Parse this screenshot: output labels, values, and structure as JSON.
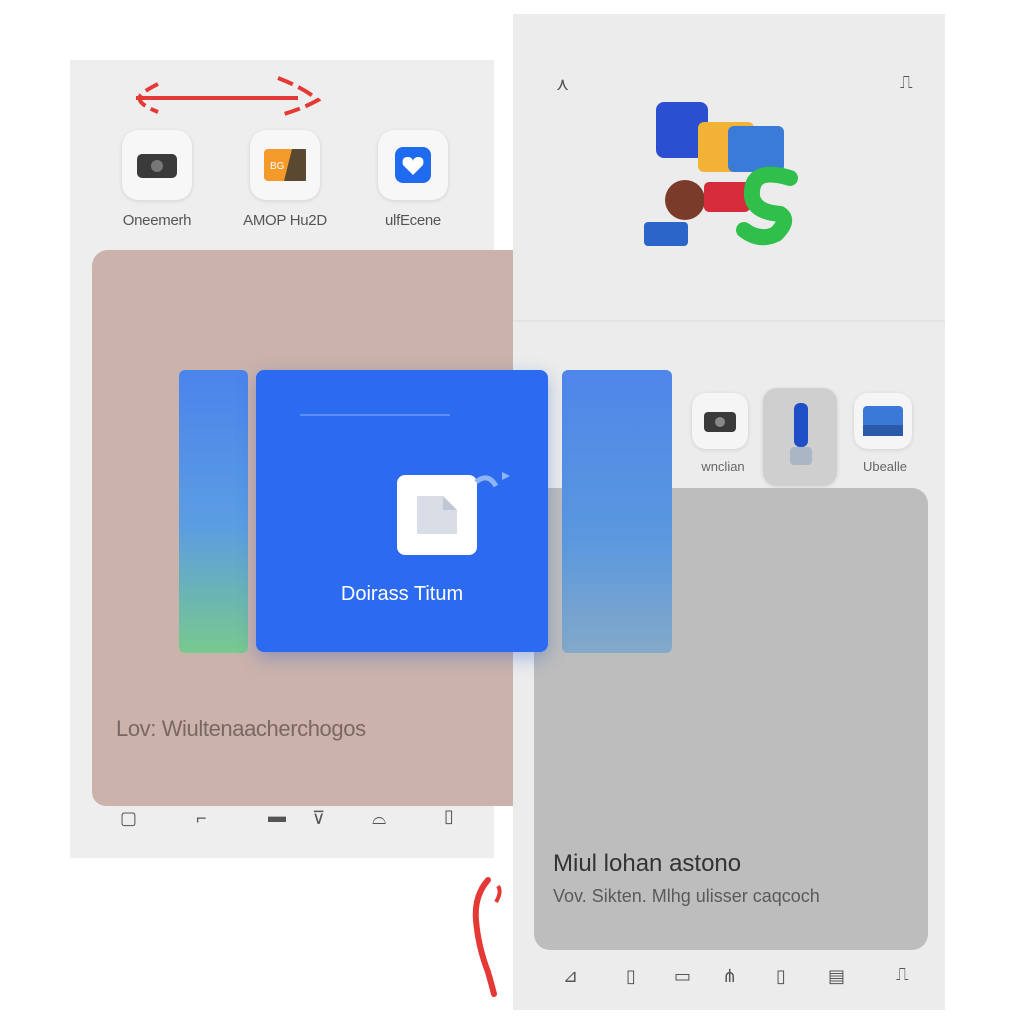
{
  "left_panel": {
    "apps": [
      {
        "label": "Oneemerh",
        "icon": "camera-icon"
      },
      {
        "label": "AMOP Hu2D",
        "icon": "photo-icon"
      },
      {
        "label": "ulfEcene",
        "icon": "heart-icon"
      }
    ],
    "card_caption": "Lov: Wiultenaacherchogos"
  },
  "center_card": {
    "title": "Doirass Titum"
  },
  "right_panel": {
    "thumb_labels": [
      "wnclian",
      "Ubealle"
    ],
    "card_title": "Miul lohan astono",
    "card_subtitle": "Vov. Sikten. Mlhg ulisser caqcoch"
  },
  "colors": {
    "accent_blue": "#2c6bef",
    "pink_card": "#cbb3ab",
    "grey_card": "#bdbdbd",
    "annotation_red": "#e53935"
  }
}
